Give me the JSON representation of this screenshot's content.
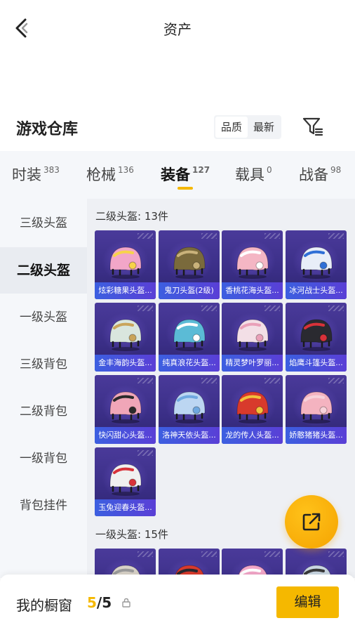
{
  "header": {
    "title": "资产"
  },
  "warehouse": {
    "title": "游戏仓库",
    "sort": [
      "品质",
      "最新"
    ]
  },
  "tabs": [
    {
      "label": "时装",
      "count": "383"
    },
    {
      "label": "枪械",
      "count": "136"
    },
    {
      "label": "装备",
      "count": "127",
      "active": true
    },
    {
      "label": "载具",
      "count": "0"
    },
    {
      "label": "战备",
      "count": "98"
    }
  ],
  "sidebar": [
    {
      "label": "三级头盔"
    },
    {
      "label": "二级头盔",
      "active": true
    },
    {
      "label": "一级头盔"
    },
    {
      "label": "三级背包"
    },
    {
      "label": "二级背包"
    },
    {
      "label": "一级背包"
    },
    {
      "label": "背包挂件"
    }
  ],
  "sections": [
    {
      "title": "二级头盔: 13件",
      "items": [
        {
          "name": "炫彩糖果头盔...",
          "color": "#f2a6c8",
          "accent": "#f7d34a"
        },
        {
          "name": "鬼刀头盔(2级)",
          "color": "#7a6a3c",
          "accent": "#c9b27a"
        },
        {
          "name": "香桃花海头盔...",
          "color": "#f4b6c4",
          "accent": "#ffffff"
        },
        {
          "name": "冰河战士头盔...",
          "color": "#e8eef8",
          "accent": "#2f6fd6"
        },
        {
          "name": "金丰海韵头盔...",
          "color": "#d9e6de",
          "accent": "#c9a45a"
        },
        {
          "name": "纯真浪花头盔...",
          "color": "#5bbbd6",
          "accent": "#ffffff"
        },
        {
          "name": "精灵梦叶罗丽...",
          "color": "#f3dfe6",
          "accent": "#e9a0b8"
        },
        {
          "name": "焰鹰斗篷头盔...",
          "color": "#2a2a30",
          "accent": "#d8323a"
        },
        {
          "name": "快闪甜心头盔...",
          "color": "#f0a6b8",
          "accent": "#2b2b2b"
        },
        {
          "name": "洛神天依头盔...",
          "color": "#bcd6f2",
          "accent": "#6fa8e0"
        },
        {
          "name": "龙的传人头盔...",
          "color": "#d83a2c",
          "accent": "#f2c23c"
        },
        {
          "name": "娇憨猪猪头盔...",
          "color": "#f4b3c0",
          "accent": "#f7d2da"
        },
        {
          "name": "玉兔迎春头盔...",
          "color": "#f0f0f0",
          "accent": "#d8323a"
        }
      ]
    },
    {
      "title": "一级头盔: 15件",
      "items": [
        {
          "name": "",
          "color": "#d8d2c8",
          "accent": "#9a9a9a"
        },
        {
          "name": "",
          "color": "#d83a2c",
          "accent": "#2a2a30"
        },
        {
          "name": "",
          "color": "#f2a6c8",
          "accent": "#ffffff"
        },
        {
          "name": "",
          "color": "#c9d6e2",
          "accent": "#3a3a3a"
        }
      ]
    }
  ],
  "bottom": {
    "label": "我的橱窗",
    "current": "5",
    "total": "/5",
    "edit": "编辑"
  },
  "colors": {
    "accent": "#f5b800",
    "cardLabel": "#3c5fe0",
    "cardBg": "#3a2e86"
  },
  "icons": {
    "back": "chevron-left-icon",
    "filter": "filter-icon",
    "share": "share-icon",
    "lock": "lock-icon"
  }
}
